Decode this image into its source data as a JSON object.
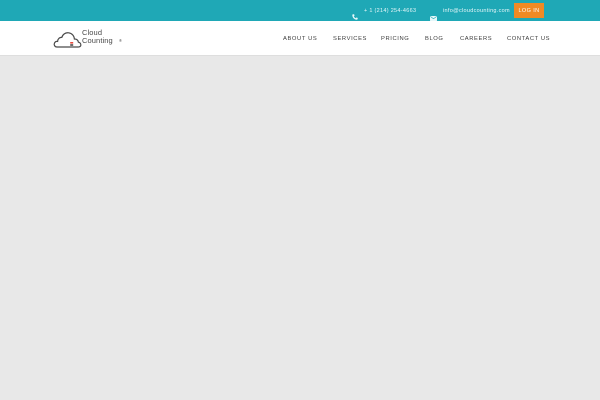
{
  "topbar": {
    "phone_icon": "phone-icon",
    "phone": "+ 1 (214) 254-4663",
    "mail_icon": "envelope-icon",
    "email": "info@cloudcounting.com",
    "login_label": "LOG IN"
  },
  "brand": {
    "logo_icon": "cloud-logo-icon",
    "line1": "Cloud",
    "line2": "Counting",
    "mark": "®"
  },
  "nav": {
    "items": [
      {
        "label": "ABOUT US"
      },
      {
        "label": "SERVICES"
      },
      {
        "label": "PRICING"
      },
      {
        "label": "BLOG"
      },
      {
        "label": "CAREERS"
      },
      {
        "label": "CONTACT US"
      }
    ]
  },
  "colors": {
    "topbar": "#1fa8b6",
    "login_button": "#f08a24",
    "navbar": "#ffffff",
    "content": "#e8e8e8"
  }
}
